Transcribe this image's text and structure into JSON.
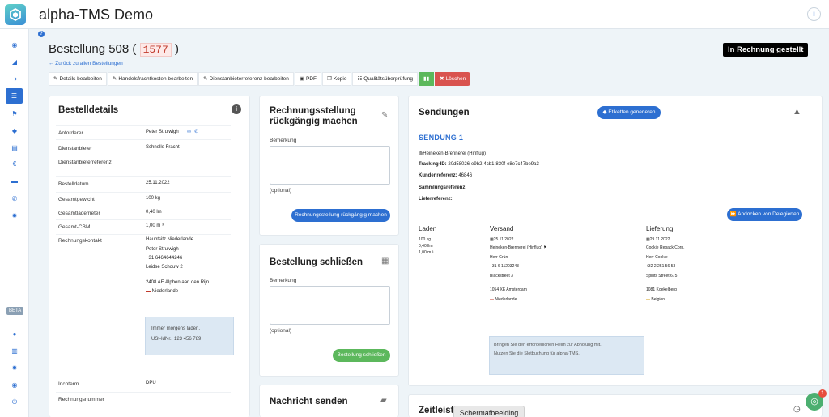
{
  "app": {
    "title": "alpha-TMS Demo",
    "info_icon": "info-icon"
  },
  "sidebar": {
    "beta": "BETA",
    "icons": [
      "eye-icon",
      "paper-plane-icon",
      "arrow-right-icon",
      "list-icon",
      "flag-icon",
      "tag-icon",
      "file-icon",
      "euro-icon",
      "briefcase-icon",
      "phone-icon",
      "gear-icon"
    ],
    "bottom_icons": [
      "user-icon",
      "bank-icon",
      "gear-icon",
      "eye-icon",
      "power-icon"
    ]
  },
  "page": {
    "title_prefix": "Bestellung 508 (",
    "title_number": "1577",
    "title_suffix": ")",
    "back_link": "← Zurück zu allen Bestellungen",
    "status": "In Rechnung gestellt"
  },
  "toolbar": {
    "edit_details": "Details bearbeiten",
    "edit_trade_freight": "Handelsfrachtkosten bearbeiten",
    "edit_provider_ref": "Dienstanbieterreferenz bearbeiten",
    "pdf": "PDF",
    "copy": "Kopie",
    "quality_check": "Qualitätsüberprüfung",
    "delete": "Löschen"
  },
  "order_details": {
    "title": "Bestelldetails",
    "rows": [
      {
        "label": "Anforderer",
        "value": "Peter Struiwigh"
      },
      {
        "label": "Dienstanbieter",
        "value": "Schnelle Fracht"
      },
      {
        "label": "Dienstanbieterreferenz",
        "value": ""
      },
      {
        "label": "Bestelldatum",
        "value": "25.11.2022"
      },
      {
        "label": "Gesamtgewicht",
        "value": "100 kg"
      },
      {
        "label": "Gesamtlademeter",
        "value": "0,40 lm"
      },
      {
        "label": "Gesamt-CBM",
        "value": "1,00 m ³"
      },
      {
        "label": "Rechnungskontakt",
        "value": "Hauptsitz Niederlande"
      }
    ],
    "contact": {
      "name": "Peter Struiwigh",
      "phone": "+31 6464644246",
      "street": "Leidse Schouw 2",
      "city": "2408 AE Alphen aan den Rijn",
      "country": "Niederlande"
    },
    "memo_line1": "Immer morgens laden.",
    "memo_line2": "USt-IdNr.: 123 456 789",
    "incoterm_label": "Incoterm",
    "incoterm_value": "DPU",
    "invoice_number_label": "Rechnungsnummer"
  },
  "undo_invoice": {
    "title_line1": "Rechnungsstellung",
    "title_line2": "rückgängig machen",
    "remark_label": "Bemerkung",
    "optional": "(optional)",
    "button": "Rechnungsstellung rückgängig machen"
  },
  "close_order": {
    "title": "Bestellung schließen",
    "remark_label": "Bemerkung",
    "optional": "(optional)",
    "button": "Bestellung schließen"
  },
  "send_message": {
    "title": "Nachricht senden"
  },
  "shipments": {
    "title": "Sendungen",
    "labels_button": "Etiketten generieren",
    "shipment_heading": "SENDUNG 1",
    "shipper": "Heineken-Brennerei (Hinflug)",
    "tracking_label": "Tracking-ID:",
    "tracking_value": "20d58026-e9b2-4cb1-830f-e8e7c47be9a3",
    "customer_ref_label": "Kundenreferenz:",
    "customer_ref_value": "46846",
    "collection_ref_label": "Sammlungsreferenz:",
    "delivery_ref_label": "Lieferreferenz:",
    "dock_button": "Andocken von Delegierten",
    "loading": {
      "heading": "Laden",
      "weight": "100 kg",
      "lm": "0,40 llm",
      "cbm": "1,00 m ³"
    },
    "dispatch": {
      "heading": "Versand",
      "date": "25.11.2022",
      "company": "Heineken-Brennerei (Hinflug)",
      "contact": "Herr Grün",
      "phone": "+31 6 11203243",
      "street": "Blackstreet 3",
      "city": "1054 XE Amsterdam",
      "country": "Niederlande"
    },
    "delivery": {
      "heading": "Lieferung",
      "date": "29.11.2022",
      "company": "Cookie Repack Corp.",
      "contact": "Herr Cookie",
      "phone": "+32 2 251 56 53",
      "street": "Spirits Street 675",
      "city": "1081 Koekelberg",
      "country": "Belgien"
    },
    "note_line1": "Bringen Sie den erforderlichen Helm zur Abholung mit.",
    "note_line2": "Nutzen Sie die Slotbuchung für alpha-TMS."
  },
  "timeline": {
    "title": "Zeitleiste"
  },
  "tooltip": "Schermafbeelding",
  "chat": {
    "badge": "1"
  }
}
